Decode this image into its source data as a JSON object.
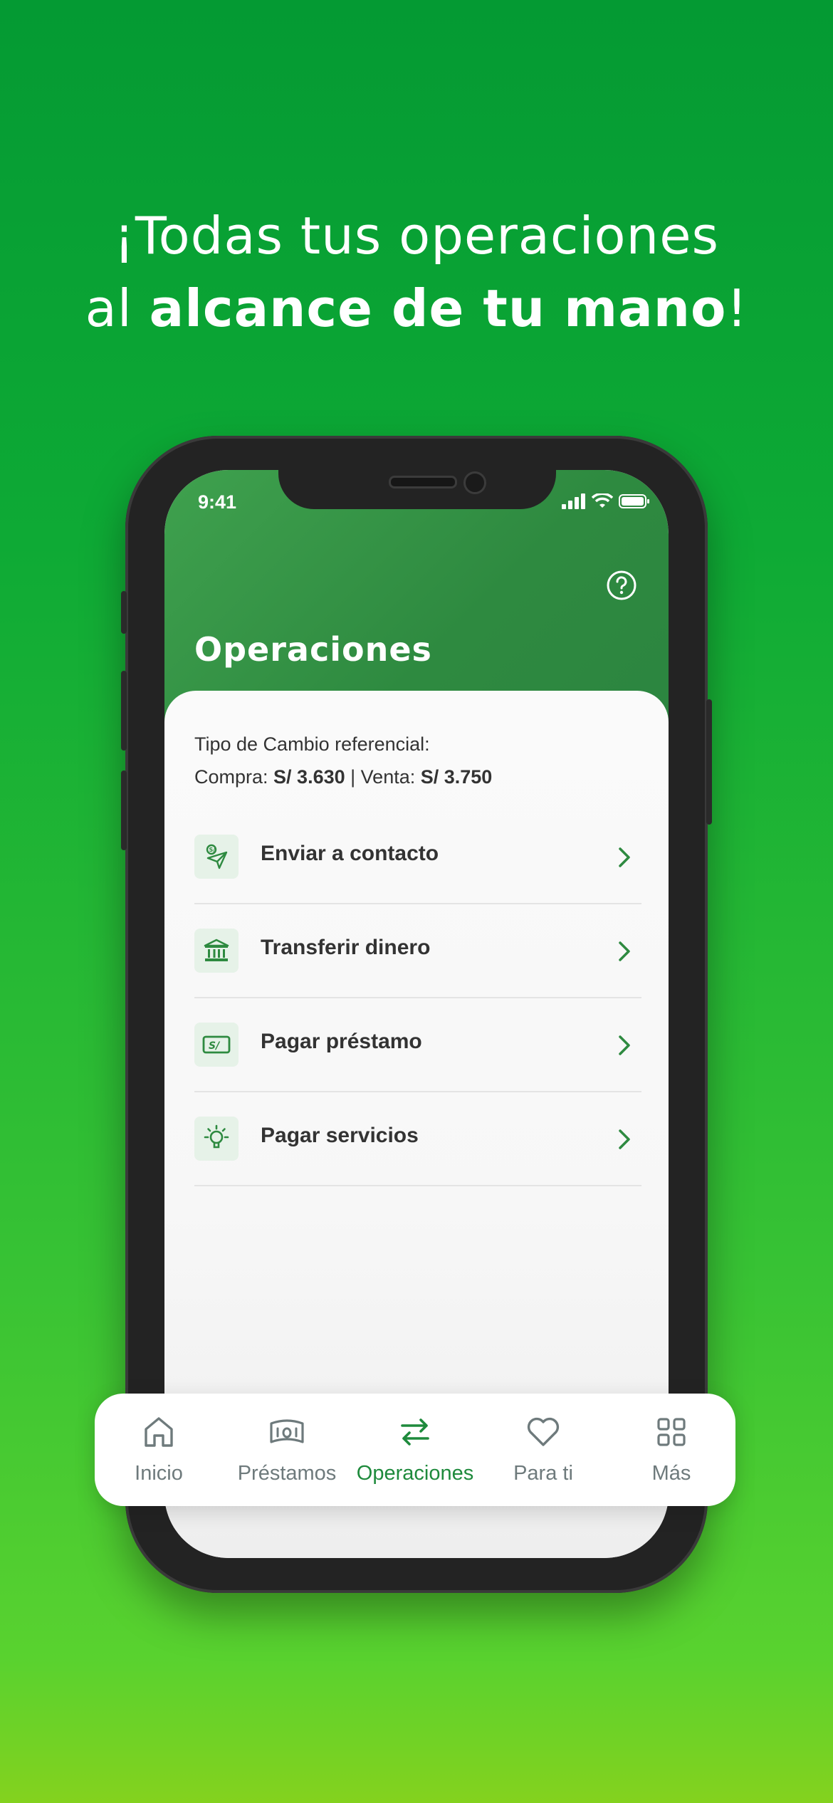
{
  "headline": {
    "line1": "¡Todas tus operaciones",
    "line2_prefix": "al ",
    "line2_bold": "alcance de tu mano",
    "line2_suffix": "!"
  },
  "status_bar": {
    "time": "9:41"
  },
  "screen": {
    "title": "Operaciones",
    "exchange_rate": {
      "label": "Tipo de Cambio referencial:",
      "buy_label": "Compra: ",
      "buy_value": "S/ 3.630",
      "separator": " | ",
      "sell_label": "Venta: ",
      "sell_value": "S/ 3.750"
    },
    "operations": [
      {
        "label": "Enviar a contacto",
        "icon": "send-contact-icon"
      },
      {
        "label": "Transferir dinero",
        "icon": "bank-icon"
      },
      {
        "label": "Pagar préstamo",
        "icon": "soles-bill-icon"
      },
      {
        "label": "Pagar servicios",
        "icon": "lightbulb-icon"
      }
    ]
  },
  "bottom_nav": {
    "items": [
      {
        "label": "Inicio",
        "icon": "home-icon",
        "active": false
      },
      {
        "label": "Préstamos",
        "icon": "money-icon",
        "active": false
      },
      {
        "label": "Operaciones",
        "icon": "transfer-arrows-icon",
        "active": true
      },
      {
        "label": "Para ti",
        "icon": "heart-icon",
        "active": false
      },
      {
        "label": "Más",
        "icon": "grid-icon",
        "active": false
      }
    ]
  },
  "colors": {
    "brand_green": "#1e8a3c",
    "nav_inactive": "#6e7a7c",
    "icon_bg": "#e6f2e8"
  }
}
